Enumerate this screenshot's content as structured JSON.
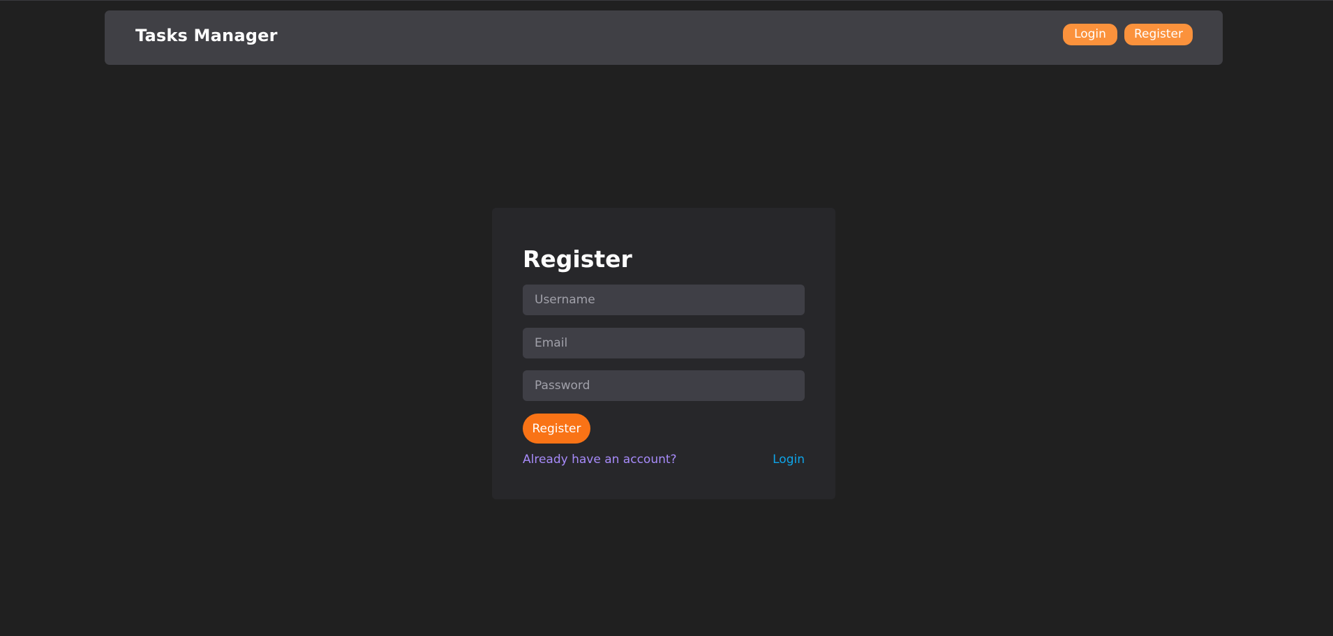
{
  "navbar": {
    "brand": "Tasks Manager",
    "login_label": "Login",
    "register_label": "Register"
  },
  "register_form": {
    "title": "Register",
    "username_placeholder": "Username",
    "email_placeholder": "Email",
    "password_placeholder": "Password",
    "submit_label": "Register",
    "have_account_text": "Already have an account?",
    "login_link": "Login"
  },
  "colors": {
    "page_background": "#202020",
    "navbar_background": "#404045",
    "card_background": "#27272a",
    "input_background": "#3f3f46",
    "accent_orange": "#f97316",
    "nav_button_orange": "#fb923c",
    "purple_text": "#a78bfa",
    "link_blue": "#0ea5e9"
  }
}
